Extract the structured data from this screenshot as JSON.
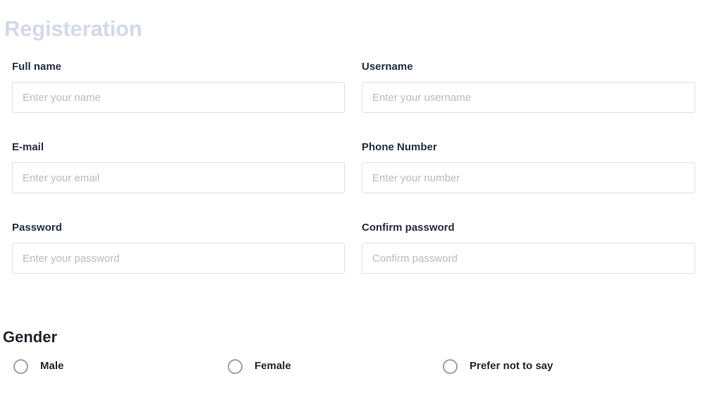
{
  "header": {
    "title": "Registeration",
    "title_color": "#d3dae6"
  },
  "theme": {
    "label_color": "#26303f",
    "placeholder_color": "#b7bcc2",
    "input_border_color": "#dcdfe3",
    "radio_border_color": "#9aa0a6",
    "background": "#ffffff"
  },
  "form": {
    "rows": [
      {
        "left": {
          "label": "Full name",
          "placeholder": "Enter your name",
          "value": "",
          "type": "text",
          "name": "full-name"
        },
        "right": {
          "label": "Username",
          "placeholder": "Enter your username",
          "value": "",
          "type": "text",
          "name": "username"
        }
      },
      {
        "left": {
          "label": "E-mail",
          "placeholder": "Enter your email",
          "value": "",
          "type": "email",
          "name": "email"
        },
        "right": {
          "label": "Phone Number",
          "placeholder": "Enter your number",
          "value": "",
          "type": "tel",
          "name": "phone-number"
        }
      },
      {
        "left": {
          "label": "Password",
          "placeholder": "Enter your password",
          "value": "",
          "type": "text",
          "name": "password"
        },
        "right": {
          "label": "Confirm password",
          "placeholder": "Confirm password",
          "value": "",
          "type": "text",
          "name": "confirm-password"
        }
      }
    ]
  },
  "gender": {
    "heading": "Gender",
    "selected": null,
    "options": [
      {
        "label": "Male",
        "value": "male",
        "checked": false
      },
      {
        "label": "Female",
        "value": "female",
        "checked": false
      },
      {
        "label": "Prefer not to say",
        "value": "prefer-not-to-say",
        "checked": false
      }
    ]
  }
}
